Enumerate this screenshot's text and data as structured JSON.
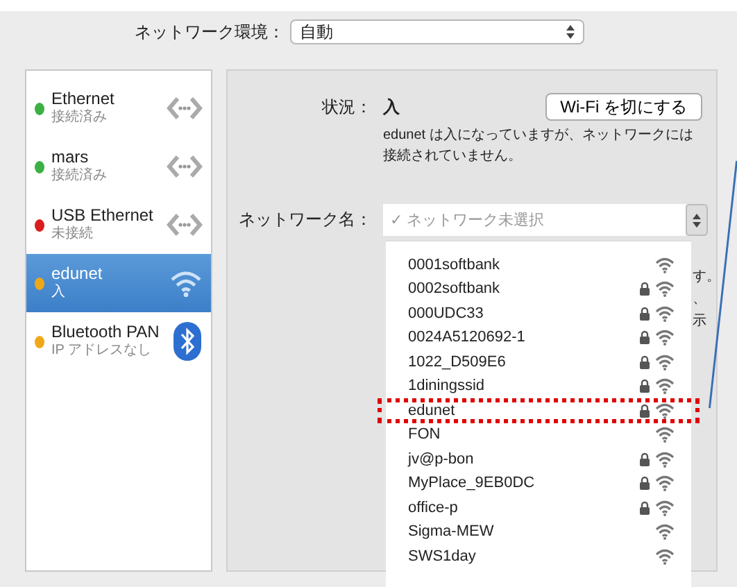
{
  "location": {
    "label": "ネットワーク環境：",
    "value": "自動"
  },
  "services": [
    {
      "name": "Ethernet",
      "status": "接続済み",
      "color": "#3cb043",
      "kind": "ethernet",
      "selected": false
    },
    {
      "name": "mars",
      "status": "接続済み",
      "color": "#3cb043",
      "kind": "ethernet",
      "selected": false
    },
    {
      "name": "USB Ethernet",
      "status": "未接続",
      "color": "#d81e1e",
      "kind": "ethernet",
      "selected": false
    },
    {
      "name": "edunet",
      "status": "入",
      "color": "#f0a818",
      "kind": "wifi",
      "selected": true
    },
    {
      "name": "Bluetooth PAN",
      "status": "IP アドレスなし",
      "color": "#f0a818",
      "kind": "bluetooth",
      "selected": false
    }
  ],
  "status": {
    "label": "状況：",
    "value": "入",
    "button": "Wi-Fi を切にする",
    "description": "edunet は入になっていますが、ネットワークには接続されていません。"
  },
  "network_name": {
    "label": "ネットワーク名：",
    "check": "✓",
    "placeholder": "ネットワーク未選択"
  },
  "hidden_text_fragments": [
    "す。",
    "、",
    "示"
  ],
  "networks": [
    {
      "name": "0001softbank",
      "locked": false,
      "highlighted": false
    },
    {
      "name": "0002softbank",
      "locked": true,
      "highlighted": false
    },
    {
      "name": "000UDC33",
      "locked": true,
      "highlighted": false
    },
    {
      "name": "0024A5120692-1",
      "locked": true,
      "highlighted": false
    },
    {
      "name": "1022_D509E6",
      "locked": true,
      "highlighted": false
    },
    {
      "name": "1diningssid",
      "locked": true,
      "highlighted": false
    },
    {
      "name": "edunet",
      "locked": true,
      "highlighted": true
    },
    {
      "name": "FON",
      "locked": false,
      "highlighted": false
    },
    {
      "name": "jv@p-bon",
      "locked": true,
      "highlighted": false
    },
    {
      "name": "MyPlace_9EB0DC",
      "locked": true,
      "highlighted": false
    },
    {
      "name": "office-p",
      "locked": true,
      "highlighted": false
    },
    {
      "name": "Sigma-MEW",
      "locked": false,
      "highlighted": false
    },
    {
      "name": "SWS1day",
      "locked": false,
      "highlighted": false
    }
  ]
}
